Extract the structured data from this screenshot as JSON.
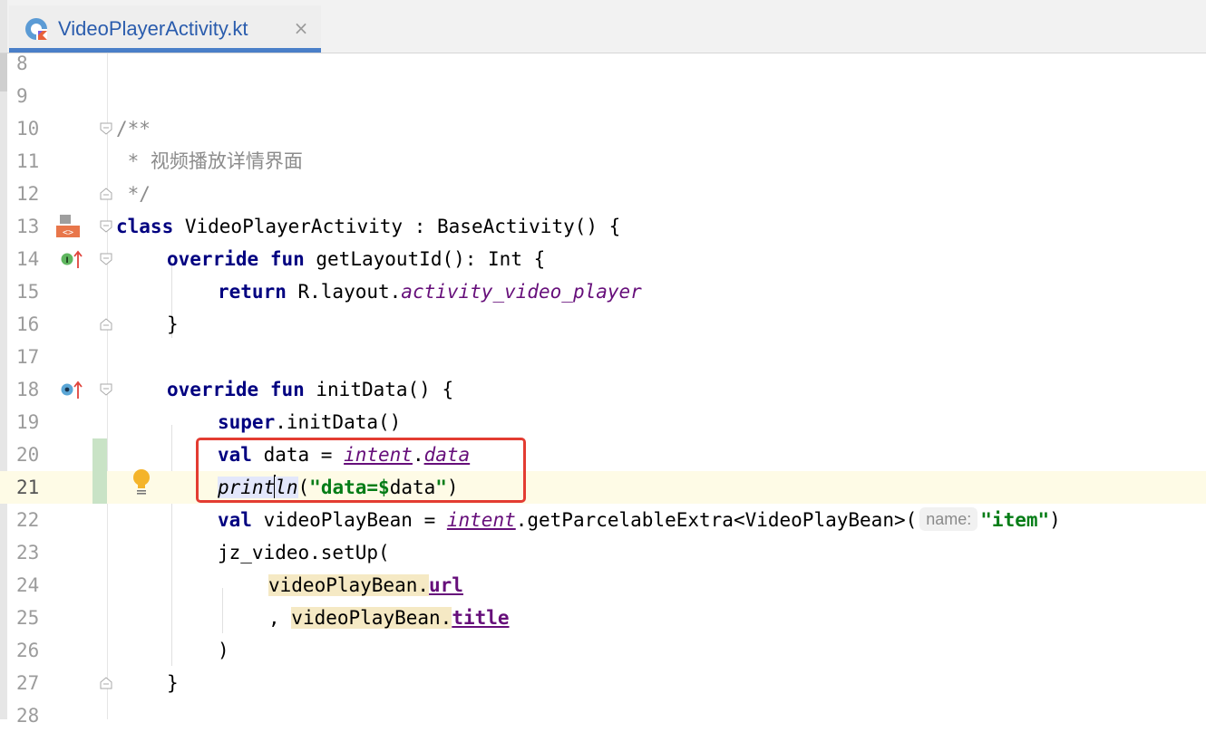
{
  "tab": {
    "filename": "VideoPlayerActivity.kt",
    "close_glyph": "×",
    "icon": "kotlin-file-icon"
  },
  "editor": {
    "current_line": "21",
    "lines": {
      "l8": {
        "num": "8"
      },
      "l9": {
        "num": "9"
      },
      "l10": {
        "num": "10",
        "t": "/**"
      },
      "l11": {
        "num": "11",
        "t": " * 视频播放详情界面"
      },
      "l12": {
        "num": "12",
        "t": " */"
      },
      "l13": {
        "num": "13",
        "a": "class",
        "b": " VideoPlayerActivity : BaseActivity() {"
      },
      "l14": {
        "num": "14",
        "a": "override",
        "b": " ",
        "c": "fun",
        "d": " getLayoutId(): Int {"
      },
      "l15": {
        "num": "15",
        "a": "return",
        "b": " R.layout.",
        "c": "activity_video_player"
      },
      "l16": {
        "num": "16",
        "t": "}"
      },
      "l17": {
        "num": "17"
      },
      "l18": {
        "num": "18",
        "a": "override",
        "b": " ",
        "c": "fun",
        "d": " initData() {"
      },
      "l19": {
        "num": "19",
        "a": "super",
        "b": ".initData()"
      },
      "l20": {
        "num": "20",
        "a": "val",
        "b": " data = ",
        "c": "intent",
        "d": ".",
        "e": "data"
      },
      "l21": {
        "num": "21",
        "a": "print",
        "b": "ln",
        "c": "(",
        "d": "\"data=$",
        "e": "data",
        "f": "\"",
        "g": ")"
      },
      "l22": {
        "num": "22",
        "a": "val",
        "b": " videoPlayBean = ",
        "c": "intent",
        "d": ".getParcelableExtra<VideoPlayBean>(",
        "hint": "name:",
        "e": "\"item\"",
        "f": ")"
      },
      "l23": {
        "num": "23",
        "t": "jz_video.setUp("
      },
      "l24": {
        "num": "24",
        "a": "videoPlayBean.",
        "b": "url"
      },
      "l25": {
        "num": "25",
        "pre": ", ",
        "a": "videoPlayBean.",
        "b": "title"
      },
      "l26": {
        "num": "26",
        "t": ")"
      },
      "l27": {
        "num": "27",
        "t": "}"
      },
      "l28": {
        "num": "28"
      }
    }
  },
  "gutter_icons": {
    "l13": "activity-layout-icon",
    "l14": "implements-method-icon",
    "l18": "overrides-method-icon",
    "l21": "intention-bulb-icon"
  },
  "colors": {
    "keyword": "#000080",
    "string": "#067d17",
    "property": "#660e7a",
    "comment": "#8c8c8c",
    "highlight_box": "#e33c32",
    "tab_accent": "#4a7fc8"
  }
}
